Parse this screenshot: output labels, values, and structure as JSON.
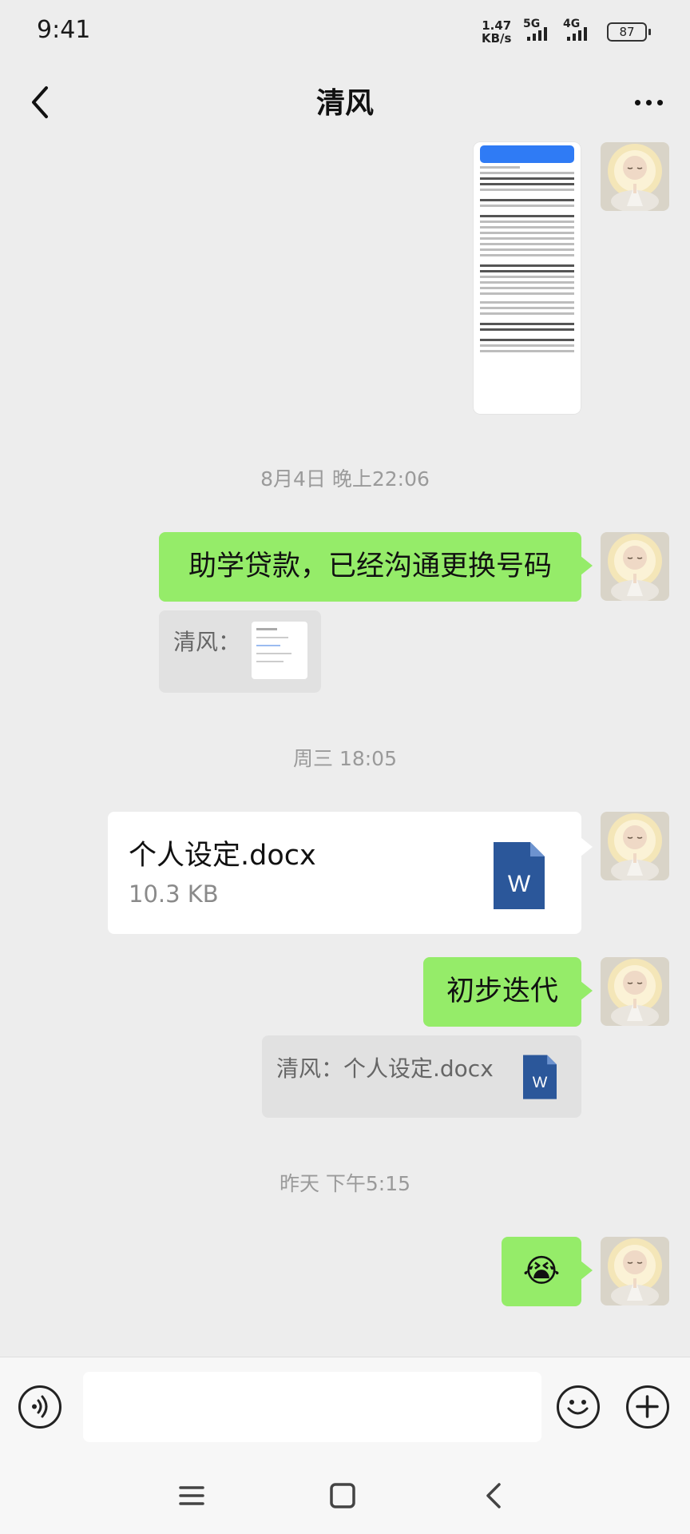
{
  "status_bar": {
    "time": "9:41",
    "net_speed_value": "1.47",
    "net_speed_unit": "KB/s",
    "signal_1": "5G",
    "signal_2": "4G",
    "battery": "87"
  },
  "header": {
    "title": "清风",
    "back_icon": "chevron-left-icon",
    "more_icon": "more-dots-icon"
  },
  "messages": {
    "ts1": "8月4日 晚上22:06",
    "msg1": "助学贷款，已经沟通更换号码",
    "quote1_label": "清风：",
    "ts2": "周三 18:05",
    "file_name": "个人设定.docx",
    "file_size": "10.3 KB",
    "msg2": "初步迭代",
    "quote2_label": "清风：个人设定.docx",
    "ts3": "昨天 下午5:15",
    "emoji": "😭"
  },
  "input_bar": {
    "voice_icon": "voice-icon",
    "emoji_icon": "emoji-icon",
    "plus_icon": "plus-icon"
  },
  "nav_bar": {
    "menu_icon": "menu-icon",
    "home_icon": "home-icon",
    "back_icon": "back-icon"
  },
  "colors": {
    "green_bubble": "#95ec69",
    "word_blue": "#2b579a",
    "background": "#ededed"
  }
}
